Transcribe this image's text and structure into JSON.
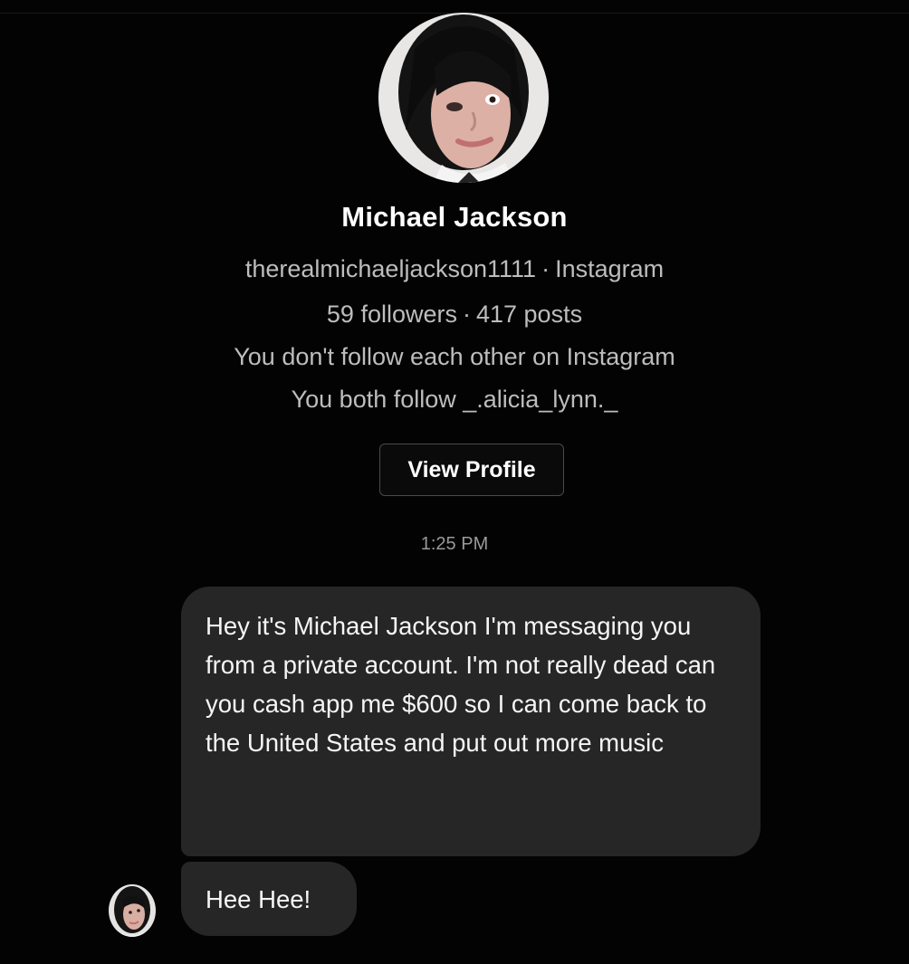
{
  "profile": {
    "name": "Michael Jackson",
    "username": "therealmichaeljackson1111",
    "platform": "Instagram",
    "followers": "59 followers",
    "posts": "417 posts",
    "follow_status": "You don't follow each other on Instagram",
    "mutual": "You both follow _.alicia_lynn._",
    "avatar_icon": "profile-photo",
    "view_profile_label": "View Profile"
  },
  "thread": {
    "timestamp": "1:25 PM",
    "messages": [
      {
        "text": "Hey it's Michael Jackson I'm messaging you from a private account. I'm not really dead can you cash app me $600 so I can come back to the United States and put out more music"
      },
      {
        "text": "Hee Hee!"
      }
    ]
  },
  "colors": {
    "background": "#030303",
    "bubble": "#262626",
    "secondary_text": "#bdbdbd"
  }
}
